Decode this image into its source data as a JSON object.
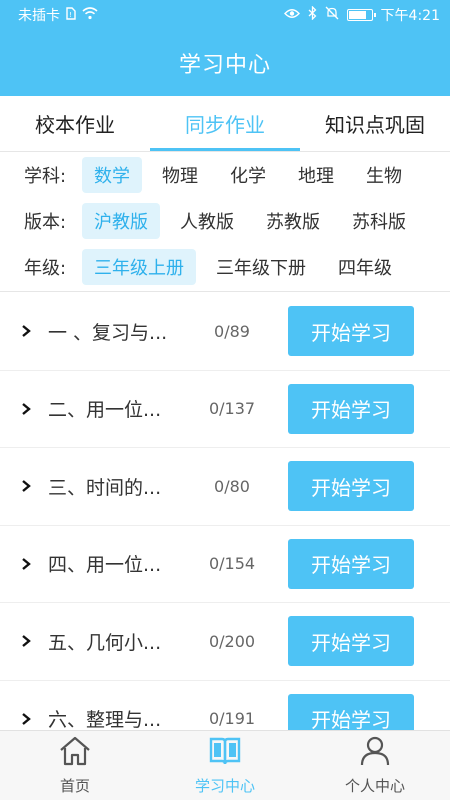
{
  "status_bar": {
    "carrier": "未插卡",
    "time": "下午4:21"
  },
  "header": {
    "title": "学习中心"
  },
  "tabs": [
    {
      "label": "校本作业",
      "active": false
    },
    {
      "label": "同步作业",
      "active": true
    },
    {
      "label": "知识点巩固",
      "active": false
    }
  ],
  "filters": {
    "subject": {
      "label": "学科:",
      "options": [
        "数学",
        "物理",
        "化学",
        "地理",
        "生物"
      ],
      "selected": "数学"
    },
    "edition": {
      "label": "版本:",
      "options": [
        "沪教版",
        "人教版",
        "苏教版",
        "苏科版"
      ],
      "selected": "沪教版"
    },
    "grade": {
      "label": "年级:",
      "options": [
        "三年级上册",
        "三年级下册",
        "四年级"
      ],
      "selected": "三年级上册"
    }
  },
  "chapters": [
    {
      "title": "一 、复习与...",
      "count": "0/89",
      "button": "开始学习"
    },
    {
      "title": "二、用一位...",
      "count": "0/137",
      "button": "开始学习"
    },
    {
      "title": "三、时间的...",
      "count": "0/80",
      "button": "开始学习"
    },
    {
      "title": "四、用一位...",
      "count": "0/154",
      "button": "开始学习"
    },
    {
      "title": "五、几何小...",
      "count": "0/200",
      "button": "开始学习"
    },
    {
      "title": "六、整理与...",
      "count": "0/191",
      "button": "开始学习"
    }
  ],
  "bottom_nav": [
    {
      "label": "首页",
      "icon": "home-icon",
      "active": false
    },
    {
      "label": "学习中心",
      "icon": "book-icon",
      "active": true
    },
    {
      "label": "个人中心",
      "icon": "person-icon",
      "active": false
    }
  ],
  "colors": {
    "accent": "#4ec3f5",
    "chip_bg": "#dff3fc"
  }
}
